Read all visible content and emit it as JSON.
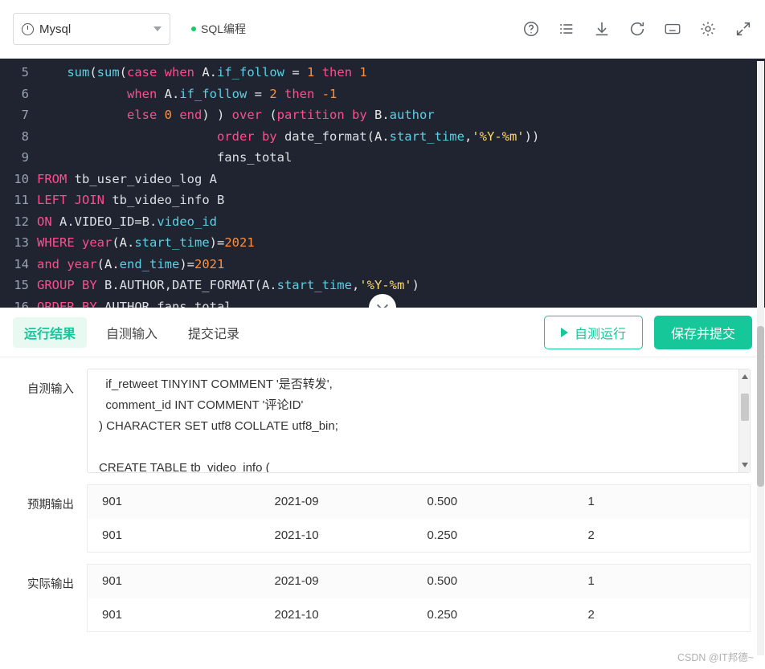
{
  "toolbar": {
    "db_label": "Mysql",
    "sql_tab_label": "SQL编程",
    "icons": [
      "help-circle-icon",
      "list-icon",
      "download-icon",
      "refresh-icon",
      "keyboard-icon",
      "gear-icon",
      "fullscreen-icon"
    ]
  },
  "editor": {
    "lines": [
      {
        "no": "5",
        "segments": [
          {
            "t": "    ",
            "c": "op"
          },
          {
            "t": "sum",
            "c": "fn"
          },
          {
            "t": "(",
            "c": "op"
          },
          {
            "t": "sum",
            "c": "fn"
          },
          {
            "t": "(",
            "c": "op"
          },
          {
            "t": "case when",
            "c": "kw"
          },
          {
            "t": " A.",
            "c": "op"
          },
          {
            "t": "if_follow",
            "c": "blue"
          },
          {
            "t": " = ",
            "c": "op"
          },
          {
            "t": "1",
            "c": "num"
          },
          {
            "t": " ",
            "c": "op"
          },
          {
            "t": "then",
            "c": "kw"
          },
          {
            "t": " ",
            "c": "op"
          },
          {
            "t": "1",
            "c": "num"
          }
        ]
      },
      {
        "no": "6",
        "segments": [
          {
            "t": "            ",
            "c": "op"
          },
          {
            "t": "when",
            "c": "kw"
          },
          {
            "t": " A.",
            "c": "op"
          },
          {
            "t": "if_follow",
            "c": "blue"
          },
          {
            "t": " = ",
            "c": "op"
          },
          {
            "t": "2",
            "c": "num"
          },
          {
            "t": " ",
            "c": "op"
          },
          {
            "t": "then",
            "c": "kw"
          },
          {
            "t": " ",
            "c": "op"
          },
          {
            "t": "-1",
            "c": "num"
          }
        ]
      },
      {
        "no": "7",
        "segments": [
          {
            "t": "            ",
            "c": "op"
          },
          {
            "t": "else",
            "c": "kw"
          },
          {
            "t": " ",
            "c": "op"
          },
          {
            "t": "0",
            "c": "num"
          },
          {
            "t": " ",
            "c": "op"
          },
          {
            "t": "end",
            "c": "kw"
          },
          {
            "t": ") ) ",
            "c": "op"
          },
          {
            "t": "over",
            "c": "kw"
          },
          {
            "t": " (",
            "c": "op"
          },
          {
            "t": "partition by",
            "c": "kw"
          },
          {
            "t": " B.",
            "c": "op"
          },
          {
            "t": "author",
            "c": "blue"
          }
        ]
      },
      {
        "no": "8",
        "segments": [
          {
            "t": "                        ",
            "c": "op"
          },
          {
            "t": "order by",
            "c": "kw"
          },
          {
            "t": " ",
            "c": "op"
          },
          {
            "t": "date_format",
            "c": "idt"
          },
          {
            "t": "(A.",
            "c": "op"
          },
          {
            "t": "start_time",
            "c": "blue"
          },
          {
            "t": ",",
            "c": "op"
          },
          {
            "t": "'%Y-%m'",
            "c": "str"
          },
          {
            "t": "))",
            "c": "op"
          }
        ]
      },
      {
        "no": "9",
        "segments": [
          {
            "t": "                        ",
            "c": "op"
          },
          {
            "t": "fans_total",
            "c": "idt"
          }
        ]
      },
      {
        "no": "10",
        "segments": [
          {
            "t": "FROM",
            "c": "kw"
          },
          {
            "t": " tb_user_video_log A",
            "c": "idt"
          }
        ]
      },
      {
        "no": "11",
        "segments": [
          {
            "t": "LEFT JOIN",
            "c": "kw"
          },
          {
            "t": " tb_video_info B",
            "c": "idt"
          }
        ]
      },
      {
        "no": "12",
        "segments": [
          {
            "t": "ON",
            "c": "kw"
          },
          {
            "t": " A.VIDEO_ID=B.",
            "c": "idt"
          },
          {
            "t": "video_id",
            "c": "blue"
          }
        ]
      },
      {
        "no": "13",
        "segments": [
          {
            "t": "WHERE",
            "c": "kw"
          },
          {
            "t": " ",
            "c": "op"
          },
          {
            "t": "year",
            "c": "pink"
          },
          {
            "t": "(A.",
            "c": "op"
          },
          {
            "t": "start_time",
            "c": "blue"
          },
          {
            "t": ")=",
            "c": "op"
          },
          {
            "t": "2021",
            "c": "num"
          }
        ]
      },
      {
        "no": "14",
        "segments": [
          {
            "t": "and",
            "c": "kw"
          },
          {
            "t": " ",
            "c": "op"
          },
          {
            "t": "year",
            "c": "pink"
          },
          {
            "t": "(A.",
            "c": "op"
          },
          {
            "t": "end_time",
            "c": "blue"
          },
          {
            "t": ")=",
            "c": "op"
          },
          {
            "t": "2021",
            "c": "num"
          }
        ]
      },
      {
        "no": "15",
        "segments": [
          {
            "t": "GROUP BY",
            "c": "kw"
          },
          {
            "t": " B.AUTHOR,DATE_FORMAT(A.",
            "c": "idt"
          },
          {
            "t": "start_time",
            "c": "blue"
          },
          {
            "t": ",",
            "c": "op"
          },
          {
            "t": "'%Y-%m'",
            "c": "str"
          },
          {
            "t": ")",
            "c": "op"
          }
        ]
      },
      {
        "no": "16",
        "segments": [
          {
            "t": "ORDER BY",
            "c": "kw"
          },
          {
            "t": " AUTHOR,fans_total",
            "c": "idt"
          }
        ]
      }
    ]
  },
  "tabs": [
    {
      "label": "运行结果",
      "active": true
    },
    {
      "label": "自测输入",
      "active": false
    },
    {
      "label": "提交记录",
      "active": false
    }
  ],
  "buttons": {
    "run_label": "自测运行",
    "submit_label": "保存并提交"
  },
  "sections": {
    "self_input_label": "自测输入",
    "expected_label": "预期输出",
    "actual_label": "实际输出"
  },
  "self_input_text": "  if_retweet TINYINT COMMENT '是否转发',\n  comment_id INT COMMENT '评论ID'\n) CHARACTER SET utf8 COLLATE utf8_bin;\n\nCREATE TABLE tb_video_info (\n  id INT PRIMARY KEY AUTO_INCREMENT COMMENT '自增ID',",
  "expected_output": {
    "rows": [
      [
        "901",
        "2021-09",
        "0.500",
        "1"
      ],
      [
        "901",
        "2021-10",
        "0.250",
        "2"
      ]
    ]
  },
  "actual_output": {
    "rows": [
      [
        "901",
        "2021-09",
        "0.500",
        "1"
      ],
      [
        "901",
        "2021-10",
        "0.250",
        "2"
      ]
    ]
  },
  "watermark": "CSDN @IT邦德~"
}
